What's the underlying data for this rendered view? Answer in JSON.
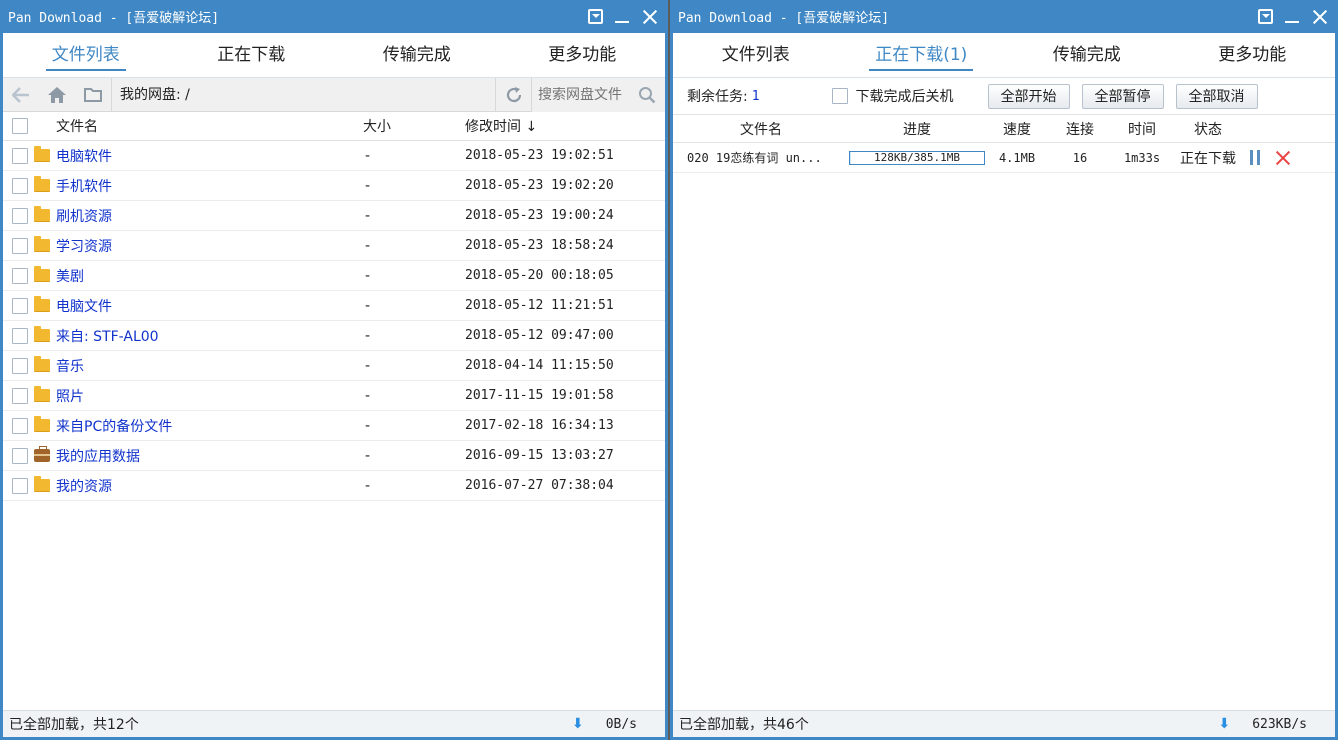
{
  "left": {
    "title": "Pan Download - [吾爱破解论坛]",
    "tabs": [
      "文件列表",
      "正在下载",
      "传输完成",
      "更多功能"
    ],
    "path": "我的网盘: /",
    "search_placeholder": "搜索网盘文件",
    "columns": {
      "name": "文件名",
      "size": "大小",
      "time": "修改时间 ↓"
    },
    "files": [
      {
        "name": "电脑软件",
        "size": "-",
        "time": "2018-05-23 19:02:51",
        "icon": "folder-icon"
      },
      {
        "name": "手机软件",
        "size": "-",
        "time": "2018-05-23 19:02:20",
        "icon": "folder-icon"
      },
      {
        "name": "刷机资源",
        "size": "-",
        "time": "2018-05-23 19:00:24",
        "icon": "folder-icon"
      },
      {
        "name": "学习资源",
        "size": "-",
        "time": "2018-05-23 18:58:24",
        "icon": "folder-icon"
      },
      {
        "name": "美剧",
        "size": "-",
        "time": "2018-05-20 00:18:05",
        "icon": "folder-icon"
      },
      {
        "name": "电脑文件",
        "size": "-",
        "time": "2018-05-12 11:21:51",
        "icon": "folder-icon"
      },
      {
        "name": "来自: STF-AL00",
        "size": "-",
        "time": "2018-05-12 09:47:00",
        "icon": "folder-icon"
      },
      {
        "name": "音乐",
        "size": "-",
        "time": "2018-04-14 11:15:50",
        "icon": "folder-icon"
      },
      {
        "name": "照片",
        "size": "-",
        "time": "2017-11-15 19:01:58",
        "icon": "folder-icon"
      },
      {
        "name": "来自PC的备份文件",
        "size": "-",
        "time": "2017-02-18 16:34:13",
        "icon": "folder-icon"
      },
      {
        "name": "我的应用数据",
        "size": "-",
        "time": "2016-09-15 13:03:27",
        "icon": "briefcase-icon"
      },
      {
        "name": "我的资源",
        "size": "-",
        "time": "2016-07-27 07:38:04",
        "icon": "folder-icon"
      }
    ],
    "status": "已全部加载，共12个",
    "speed": "0B/s"
  },
  "right": {
    "title": "Pan Download - [吾爱破解论坛]",
    "tabs": [
      "文件列表",
      "正在下载(1)",
      "传输完成",
      "更多功能"
    ],
    "remaining_label": "剩余任务:",
    "remaining_count": "1",
    "shutdown_label": "下载完成后关机",
    "buttons": {
      "start_all": "全部开始",
      "pause_all": "全部暂停",
      "cancel_all": "全部取消"
    },
    "columns": {
      "name": "文件名",
      "progress": "进度",
      "speed": "速度",
      "conn": "连接",
      "time": "时间",
      "state": "状态"
    },
    "downloads": [
      {
        "name": "020 19恋练有词 un...",
        "progress_text": "128KB/385.1MB",
        "progress_fraction": 0.0003,
        "speed": "4.1MB",
        "conn": "16",
        "time": "1m33s",
        "state": "正在下载"
      }
    ],
    "status": "已全部加载，共46个",
    "speed": "623KB/s"
  },
  "colors": {
    "accent": "#3f88c5",
    "link": "#1133cc",
    "delete": "#e84747"
  }
}
